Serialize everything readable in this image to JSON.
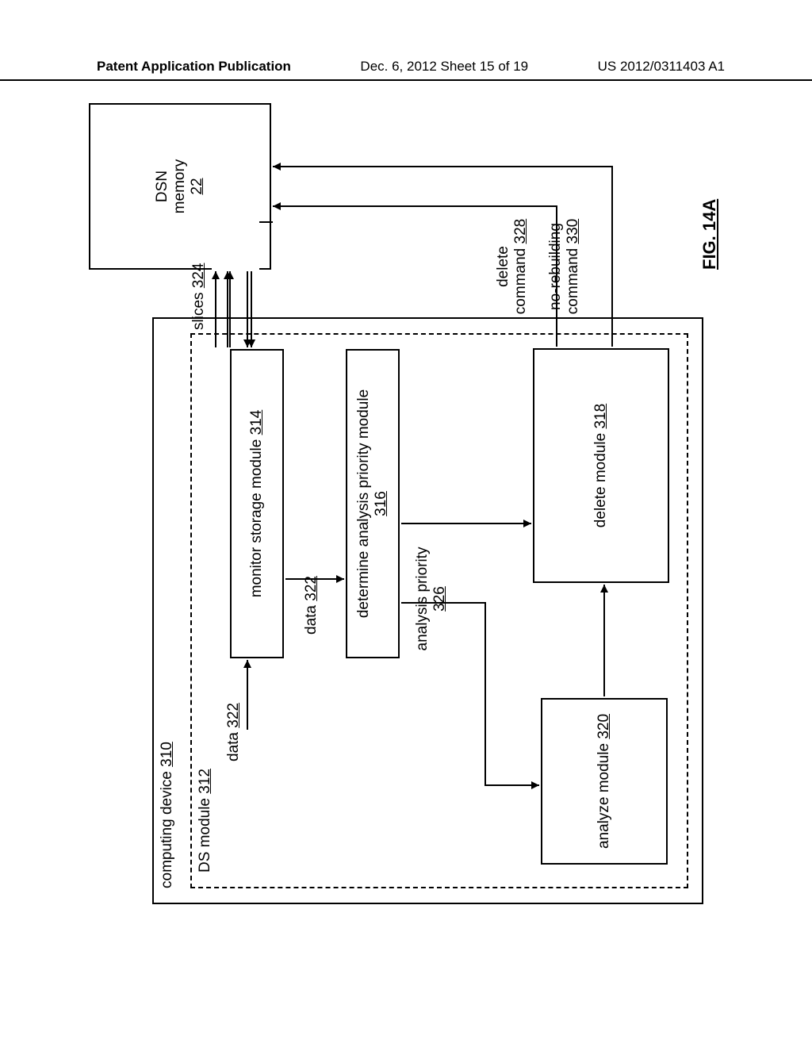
{
  "header": {
    "left": "Patent Application Publication",
    "mid": "Dec. 6, 2012   Sheet 15 of 19",
    "right": "US 2012/0311403 A1"
  },
  "diagram": {
    "computing_device": {
      "label": "computing device",
      "ref": "310"
    },
    "ds_module": {
      "label": "DS module",
      "ref": "312"
    },
    "monitor": {
      "label": "monitor storage module",
      "ref": "314"
    },
    "determine": {
      "label": "determine analysis priority module",
      "ref": "316"
    },
    "delete": {
      "label": "delete module",
      "ref": "318"
    },
    "analyze": {
      "label": "analyze module",
      "ref": "320"
    },
    "dsn": {
      "label_a": "DSN",
      "label_b": "memory",
      "ref": "22"
    },
    "data": {
      "label": "data",
      "ref": "322"
    },
    "slices": {
      "label": "slices",
      "ref": "324"
    },
    "analysis_priority": {
      "label": "analysis priority",
      "ref": "326"
    },
    "delete_cmd": {
      "label_a": "delete",
      "label_b": "command",
      "ref": "328"
    },
    "norebuild": {
      "label_a": "no-rebuilding",
      "label_b": "command",
      "ref": "330"
    },
    "fig": "FIG. 14A"
  }
}
